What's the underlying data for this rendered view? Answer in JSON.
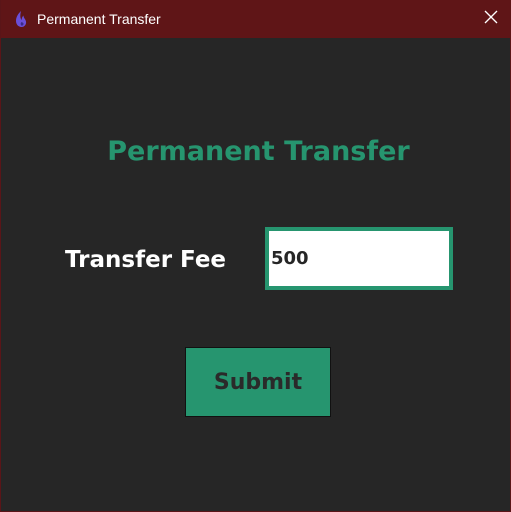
{
  "window": {
    "title": "Permanent Transfer",
    "app_icon": "flame-icon",
    "close_icon": "close-icon"
  },
  "form": {
    "heading": "Permanent Transfer",
    "fee_label": "Transfer Fee",
    "fee_value": "500",
    "submit_label": "Submit"
  },
  "colors": {
    "titlebar": "#5f1517",
    "background": "#262626",
    "accent": "#26956f",
    "text": "#ffffff"
  }
}
